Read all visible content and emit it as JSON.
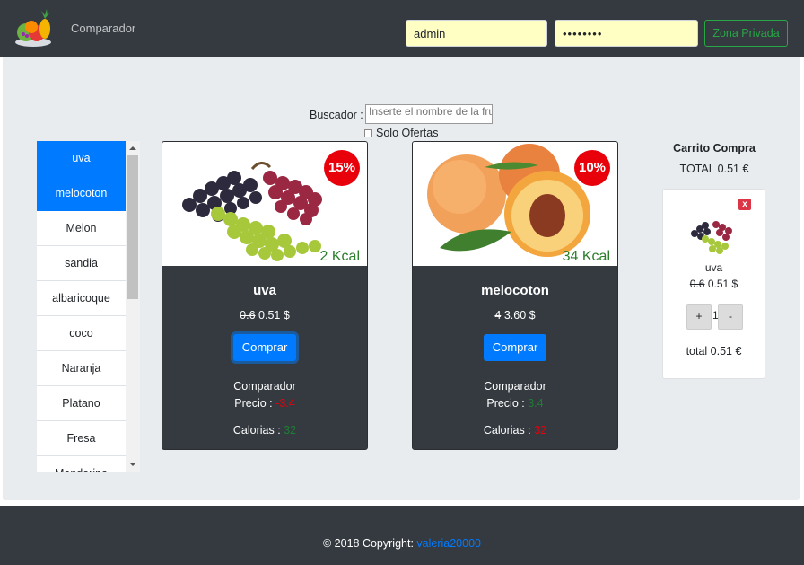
{
  "header": {
    "brand": "Comparador",
    "username_value": "admin",
    "password_value": "••••••••",
    "private_zone_label": "Zona Privada"
  },
  "search": {
    "label": "Buscador :",
    "placeholder": "Inserte el nombre de la fruta",
    "offers_label": "Solo Ofertas"
  },
  "fruit_list": {
    "items": [
      "uva",
      "melocoton",
      "Melon",
      "sandia",
      "albaricoque",
      "coco",
      "Naranja",
      "Platano",
      "Fresa",
      "Mandarina"
    ],
    "selected": [
      "uva",
      "melocoton"
    ]
  },
  "products": [
    {
      "name": "uva",
      "discount": "15%",
      "kcal": "2 Kcal",
      "old_price": "0.6",
      "new_price": "0.51 $",
      "buy_label": "Comprar",
      "comparator_label": "Comparador",
      "price_label": "Precio :",
      "price_diff": "-3.4",
      "calories_label": "Calorias :",
      "calories_diff": "32"
    },
    {
      "name": "melocoton",
      "discount": "10%",
      "kcal": "34 Kcal",
      "old_price": "4",
      "new_price": "3.60 $",
      "buy_label": "Comprar",
      "comparator_label": "Comparador",
      "price_label": "Precio :",
      "price_diff": "3.4",
      "calories_label": "Calorias :",
      "calories_diff": "32"
    }
  ],
  "cart": {
    "title": "Carrito Compra",
    "total": "TOTAL 0.51 €",
    "item": {
      "close": "x",
      "name": "uva",
      "old_price": "0.6",
      "new_price": "0.51 $",
      "plus": "+",
      "qty": "1",
      "minus": "-",
      "subtotal": "total 0.51 €"
    }
  },
  "footer": {
    "copyright": "© 2018 Copyright:",
    "author": "valeria20000"
  },
  "colors": {
    "navbar": "#343a40",
    "accent": "#007bff",
    "badge": "#e8000b",
    "success": "#28a745"
  }
}
